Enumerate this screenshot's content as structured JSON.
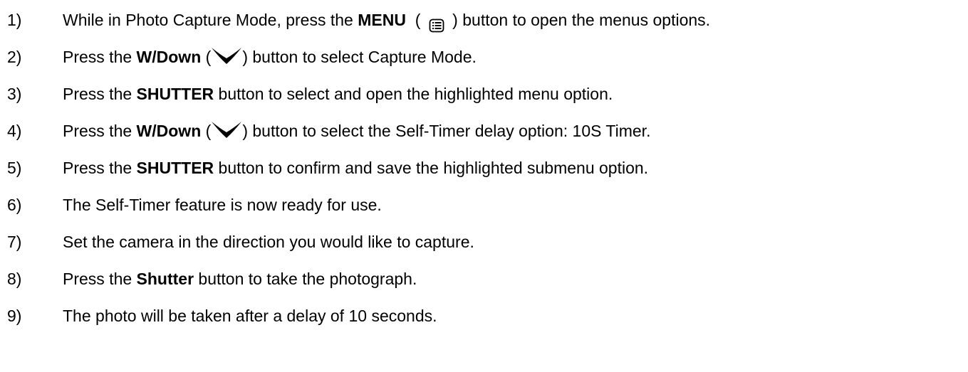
{
  "steps": [
    {
      "num": "1)",
      "parts": [
        {
          "t": "text",
          "v": "While in Photo Capture Mode, press the "
        },
        {
          "t": "bold",
          "v": "MENU"
        },
        {
          "t": "text",
          "v": "  ( "
        },
        {
          "t": "icon",
          "v": "menu-list-icon"
        },
        {
          "t": "text",
          "v": " ) button to open the menus options."
        }
      ]
    },
    {
      "num": "2)",
      "parts": [
        {
          "t": "text",
          "v": "Press the "
        },
        {
          "t": "bold",
          "v": "W/Down"
        },
        {
          "t": "text",
          "v": " ("
        },
        {
          "t": "icon",
          "v": "down-chevron-icon"
        },
        {
          "t": "text",
          "v": ") button to select Capture Mode."
        }
      ]
    },
    {
      "num": "3)",
      "parts": [
        {
          "t": "text",
          "v": "Press the "
        },
        {
          "t": "bold",
          "v": "SHUTTER"
        },
        {
          "t": "text",
          "v": " button to select and open the highlighted menu option."
        }
      ]
    },
    {
      "num": "4)",
      "parts": [
        {
          "t": "text",
          "v": "Press the "
        },
        {
          "t": "bold",
          "v": "W/Down"
        },
        {
          "t": "text",
          "v": " ("
        },
        {
          "t": "icon",
          "v": "down-chevron-icon"
        },
        {
          "t": "text",
          "v": ") button to select the Self-Timer delay option: 10S Timer."
        }
      ]
    },
    {
      "num": "5)",
      "parts": [
        {
          "t": "text",
          "v": "Press the "
        },
        {
          "t": "bold",
          "v": "SHUTTER"
        },
        {
          "t": "text",
          "v": " button to confirm and save the highlighted submenu option."
        }
      ]
    },
    {
      "num": "6)",
      "parts": [
        {
          "t": "text",
          "v": "The Self-Timer feature is now ready for use."
        }
      ]
    },
    {
      "num": "7)",
      "parts": [
        {
          "t": "text",
          "v": "Set the camera in the direction you would like to capture."
        }
      ]
    },
    {
      "num": "8)",
      "parts": [
        {
          "t": "text",
          "v": "Press the "
        },
        {
          "t": "bold",
          "v": "Shutter"
        },
        {
          "t": "text",
          "v": " button to take the photograph."
        }
      ]
    },
    {
      "num": "9)",
      "parts": [
        {
          "t": "text",
          "v": "The photo will be taken after a delay of 10 seconds."
        }
      ]
    }
  ]
}
